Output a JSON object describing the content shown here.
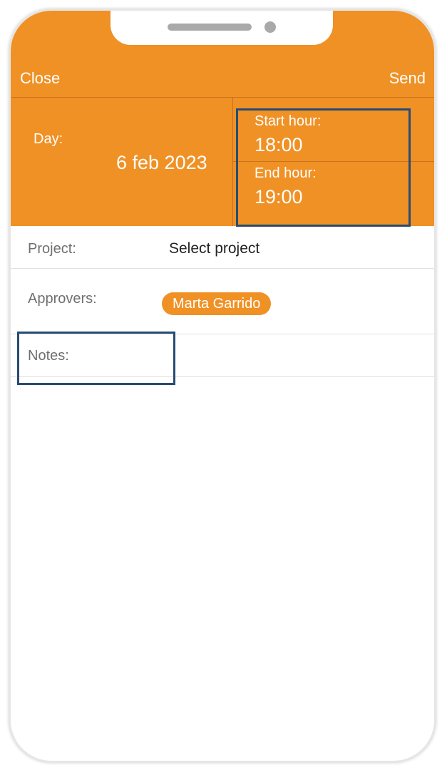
{
  "nav": {
    "close_label": "Close",
    "send_label": "Send"
  },
  "date_section": {
    "day_label": "Day:",
    "day_value": "6 feb 2023",
    "start_label": "Start hour:",
    "start_value": "18:00",
    "end_label": "End hour:",
    "end_value": "19:00"
  },
  "form": {
    "project_label": "Project:",
    "project_value": "Select project",
    "approvers_label": "Approvers:",
    "approvers": [
      "Marta Garrido"
    ],
    "notes_label": "Notes:"
  },
  "colors": {
    "accent": "#f09125",
    "highlight_box": "#284b73"
  }
}
